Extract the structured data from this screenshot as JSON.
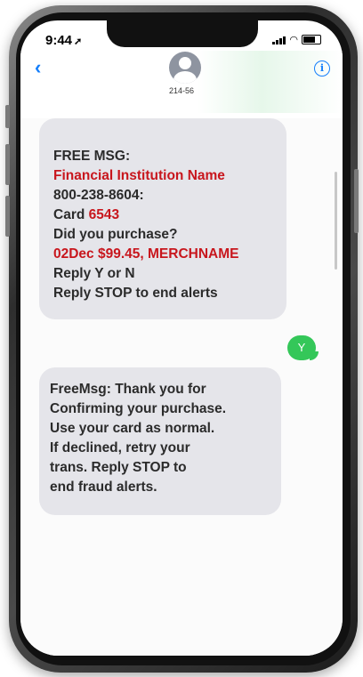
{
  "status_bar": {
    "time": "9:44"
  },
  "header": {
    "contact": "214-56"
  },
  "messages": {
    "received_1": {
      "lines": [
        {
          "text": "FREE MSG:",
          "highlight": false
        },
        {
          "text": "Financial Institution Name",
          "highlight": true
        },
        {
          "text": "800-238-8604:",
          "highlight": false
        },
        {
          "text_prefix": "Card ",
          "text_highlight": "6543"
        },
        {
          "text": "Did you purchase?",
          "highlight": false
        },
        {
          "text": "02Dec $99.45, MERCHNAME",
          "highlight": true
        },
        {
          "text": "Reply Y or N",
          "highlight": false
        },
        {
          "text": "Reply STOP to end alerts",
          "highlight": false
        }
      ]
    },
    "sent_1": "Y",
    "received_2": {
      "lines": [
        "FreeMsg: Thank you for",
        "Confirming your purchase.",
        "Use your card as normal.",
        "If declined, retry your",
        "trans. Reply STOP to",
        "end fraud alerts."
      ]
    }
  },
  "colors": {
    "highlight_text": "#c8161d",
    "received_bubble": "#e5e5ea",
    "sent_bubble": "#34c759",
    "accent": "#147efb"
  }
}
